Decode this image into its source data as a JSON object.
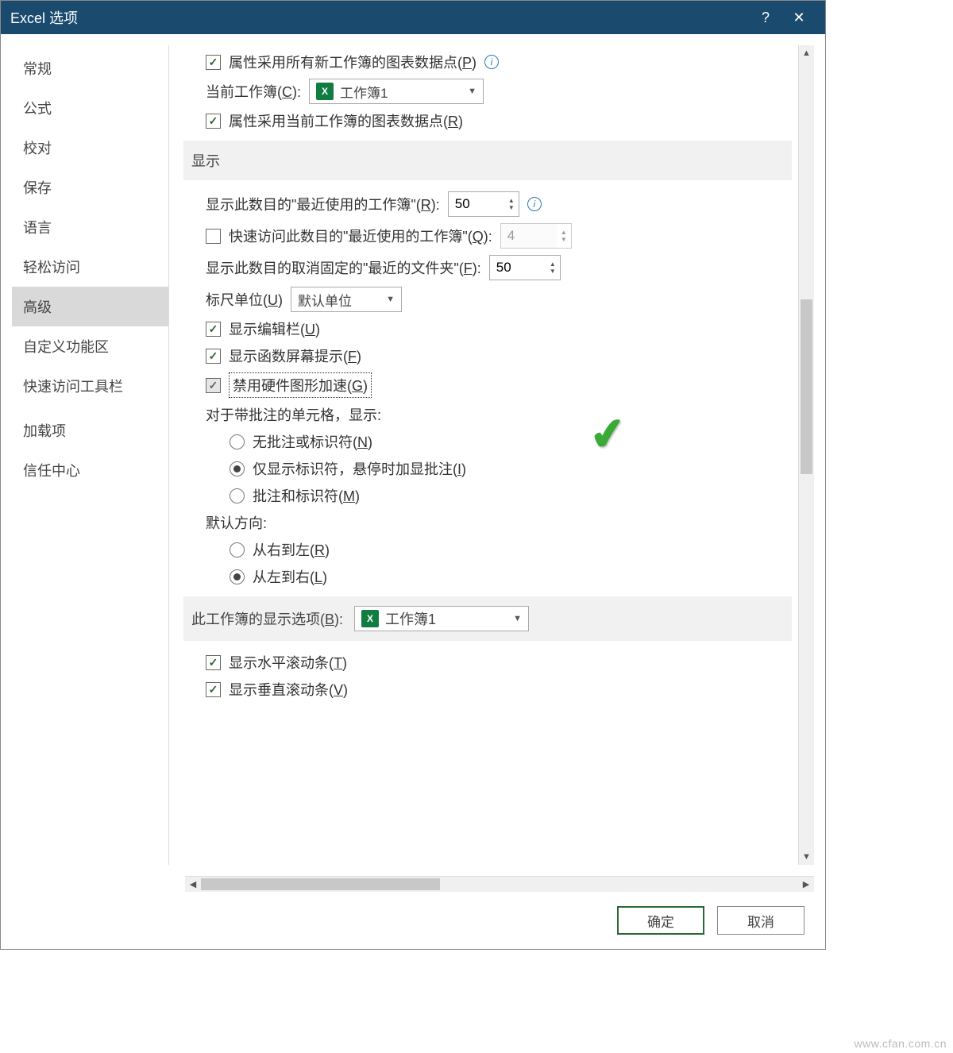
{
  "window": {
    "title": "Excel 选项"
  },
  "sidebar": {
    "items": [
      {
        "label": "常规"
      },
      {
        "label": "公式"
      },
      {
        "label": "校对"
      },
      {
        "label": "保存"
      },
      {
        "label": "语言"
      },
      {
        "label": "轻松访问"
      },
      {
        "label": "高级"
      },
      {
        "label": "自定义功能区"
      },
      {
        "label": "快速访问工具栏"
      },
      {
        "label": "加载项"
      },
      {
        "label": "信任中心"
      }
    ]
  },
  "top": {
    "prop_all_label_pre": "属性采用所有新工作簿的图表数据点(",
    "prop_all_key": "P",
    "prop_all_label_post": ")",
    "current_wb_label_pre": "当前工作簿(",
    "current_wb_key": "C",
    "current_wb_label_post": "):",
    "current_wb_value": "工作簿1",
    "prop_cur_label_pre": "属性采用当前工作簿的图表数据点(",
    "prop_cur_key": "R",
    "prop_cur_label_post": ")"
  },
  "sections": {
    "display": "显示",
    "wb_display_pre": "此工作簿的显示选项(",
    "wb_display_key": "B",
    "wb_display_post": "):",
    "wb_display_value": "工作簿1"
  },
  "display": {
    "recent_wb_label_pre": "显示此数目的\"最近使用的工作簿\"(",
    "recent_wb_key": "R",
    "recent_wb_label_post": "):",
    "recent_wb_value": "50",
    "quick_access_label_pre": "快速访问此数目的\"最近使用的工作簿\"(",
    "quick_access_key": "Q",
    "quick_access_label_post": "):",
    "quick_access_value": "4",
    "recent_folders_label_pre": "显示此数目的取消固定的\"最近的文件夹\"(",
    "recent_folders_key": "F",
    "recent_folders_label_post": "):",
    "recent_folders_value": "50",
    "ruler_label_pre": "标尺单位(",
    "ruler_key": "U",
    "ruler_label_post": ")",
    "ruler_value": "默认单位",
    "show_formula_bar_pre": "显示编辑栏(",
    "show_formula_bar_key": "U",
    "show_formula_bar_post": ")",
    "show_func_tips_pre": "显示函数屏幕提示(",
    "show_func_tips_key": "F",
    "show_func_tips_post": ")",
    "disable_hw_pre": "禁用硬件图形加速(",
    "disable_hw_key": "G",
    "disable_hw_post": ")",
    "comments_header": "对于带批注的单元格，显示:",
    "comment_none_pre": "无批注或标识符(",
    "comment_none_key": "N",
    "comment_none_post": ")",
    "comment_ind_pre": "仅显示标识符，悬停时加显批注(",
    "comment_ind_key": "I",
    "comment_ind_post": ")",
    "comment_both_pre": "批注和标识符(",
    "comment_both_key": "M",
    "comment_both_post": ")",
    "direction_header": "默认方向:",
    "rtl_pre": "从右到左(",
    "rtl_key": "R",
    "rtl_post": ")",
    "ltr_pre": "从左到右(",
    "ltr_key": "L",
    "ltr_post": ")"
  },
  "wb_display": {
    "hscroll_pre": "显示水平滚动条(",
    "hscroll_key": "T",
    "hscroll_post": ")",
    "vscroll_pre": "显示垂直滚动条(",
    "vscroll_key": "V",
    "vscroll_post": ")"
  },
  "footer": {
    "ok": "确定",
    "cancel": "取消"
  },
  "watermark": "www.cfan.com.cn"
}
